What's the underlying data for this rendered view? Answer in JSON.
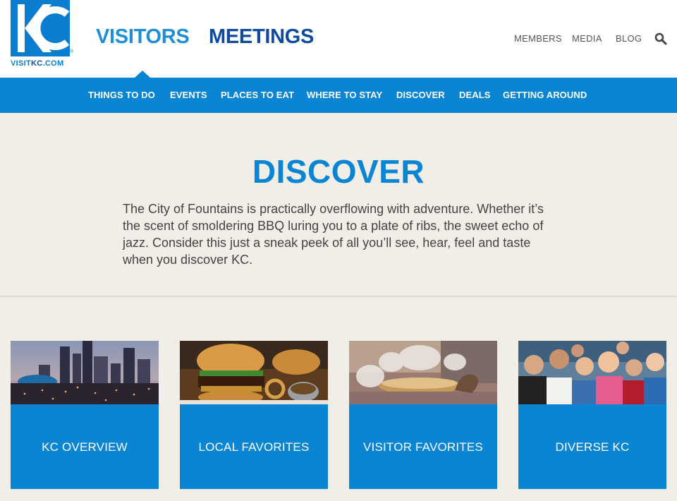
{
  "header": {
    "logo": {
      "text_visit": "VISIT",
      "text_kc": "KC",
      "text_com": ".COM",
      "reg": "®"
    },
    "main_nav": {
      "visitors": "VISITORS",
      "meetings": "MEETINGS"
    },
    "utility": {
      "members": "MEMBERS",
      "media": "MEDIA",
      "blog": "BLOG"
    }
  },
  "subnav": [
    "THINGS TO DO",
    "EVENTS",
    "PLACES TO EAT",
    "WHERE TO STAY",
    "DISCOVER",
    "DEALS",
    "GETTING AROUND"
  ],
  "hero": {
    "title": "DISCOVER",
    "text": "The City of Fountains is practically overflowing with adventure. Whether it’s the scent of smoldering BBQ luring you to a plate of ribs, the sweet echo of jazz. Consider this just a sneak peek of all you’ll see, hear, feel and taste when you discover KC."
  },
  "cards": [
    {
      "label": "KC OVERVIEW"
    },
    {
      "label": "LOCAL FAVORITES"
    },
    {
      "label": "VISITOR FAVORITES"
    },
    {
      "label": "DIVERSE KC"
    }
  ],
  "colors": {
    "primary": "#0a85d4",
    "dark_blue": "#0d4aa0",
    "background": "#f1eee8"
  }
}
